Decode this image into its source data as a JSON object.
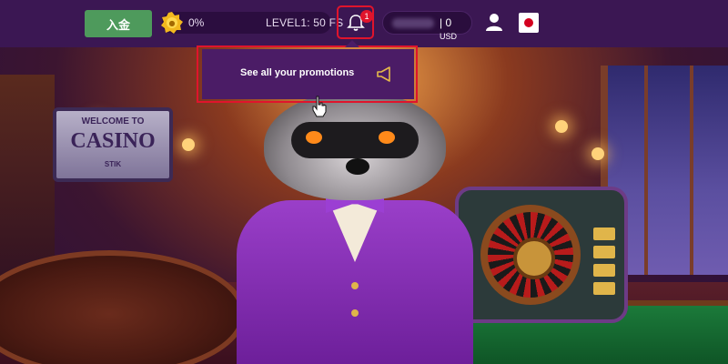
{
  "header": {
    "deposit_label": "入金",
    "level_percent": "0%",
    "level_progress": 0,
    "level_text": "LEVEL1: 50 FS",
    "notifications_count": "1",
    "balance_amount": "| 0",
    "balance_currency": "USD",
    "icons": {
      "level": "crown-coin-icon",
      "bell": "bell-icon",
      "user": "user-icon",
      "flag": "japan-flag-icon"
    }
  },
  "promo_dropdown": {
    "link_label": "See all your promotions",
    "icon": "megaphone-icon"
  },
  "hero": {
    "sign_welcome": "WELCOME TO",
    "sign_casino": "CASINO",
    "sign_sub": "STIK"
  },
  "colors": {
    "topbar": "#3b1753",
    "deposit": "#4e9a5c",
    "highlight": "#e0142c",
    "dropdown": "#4b1c66"
  }
}
